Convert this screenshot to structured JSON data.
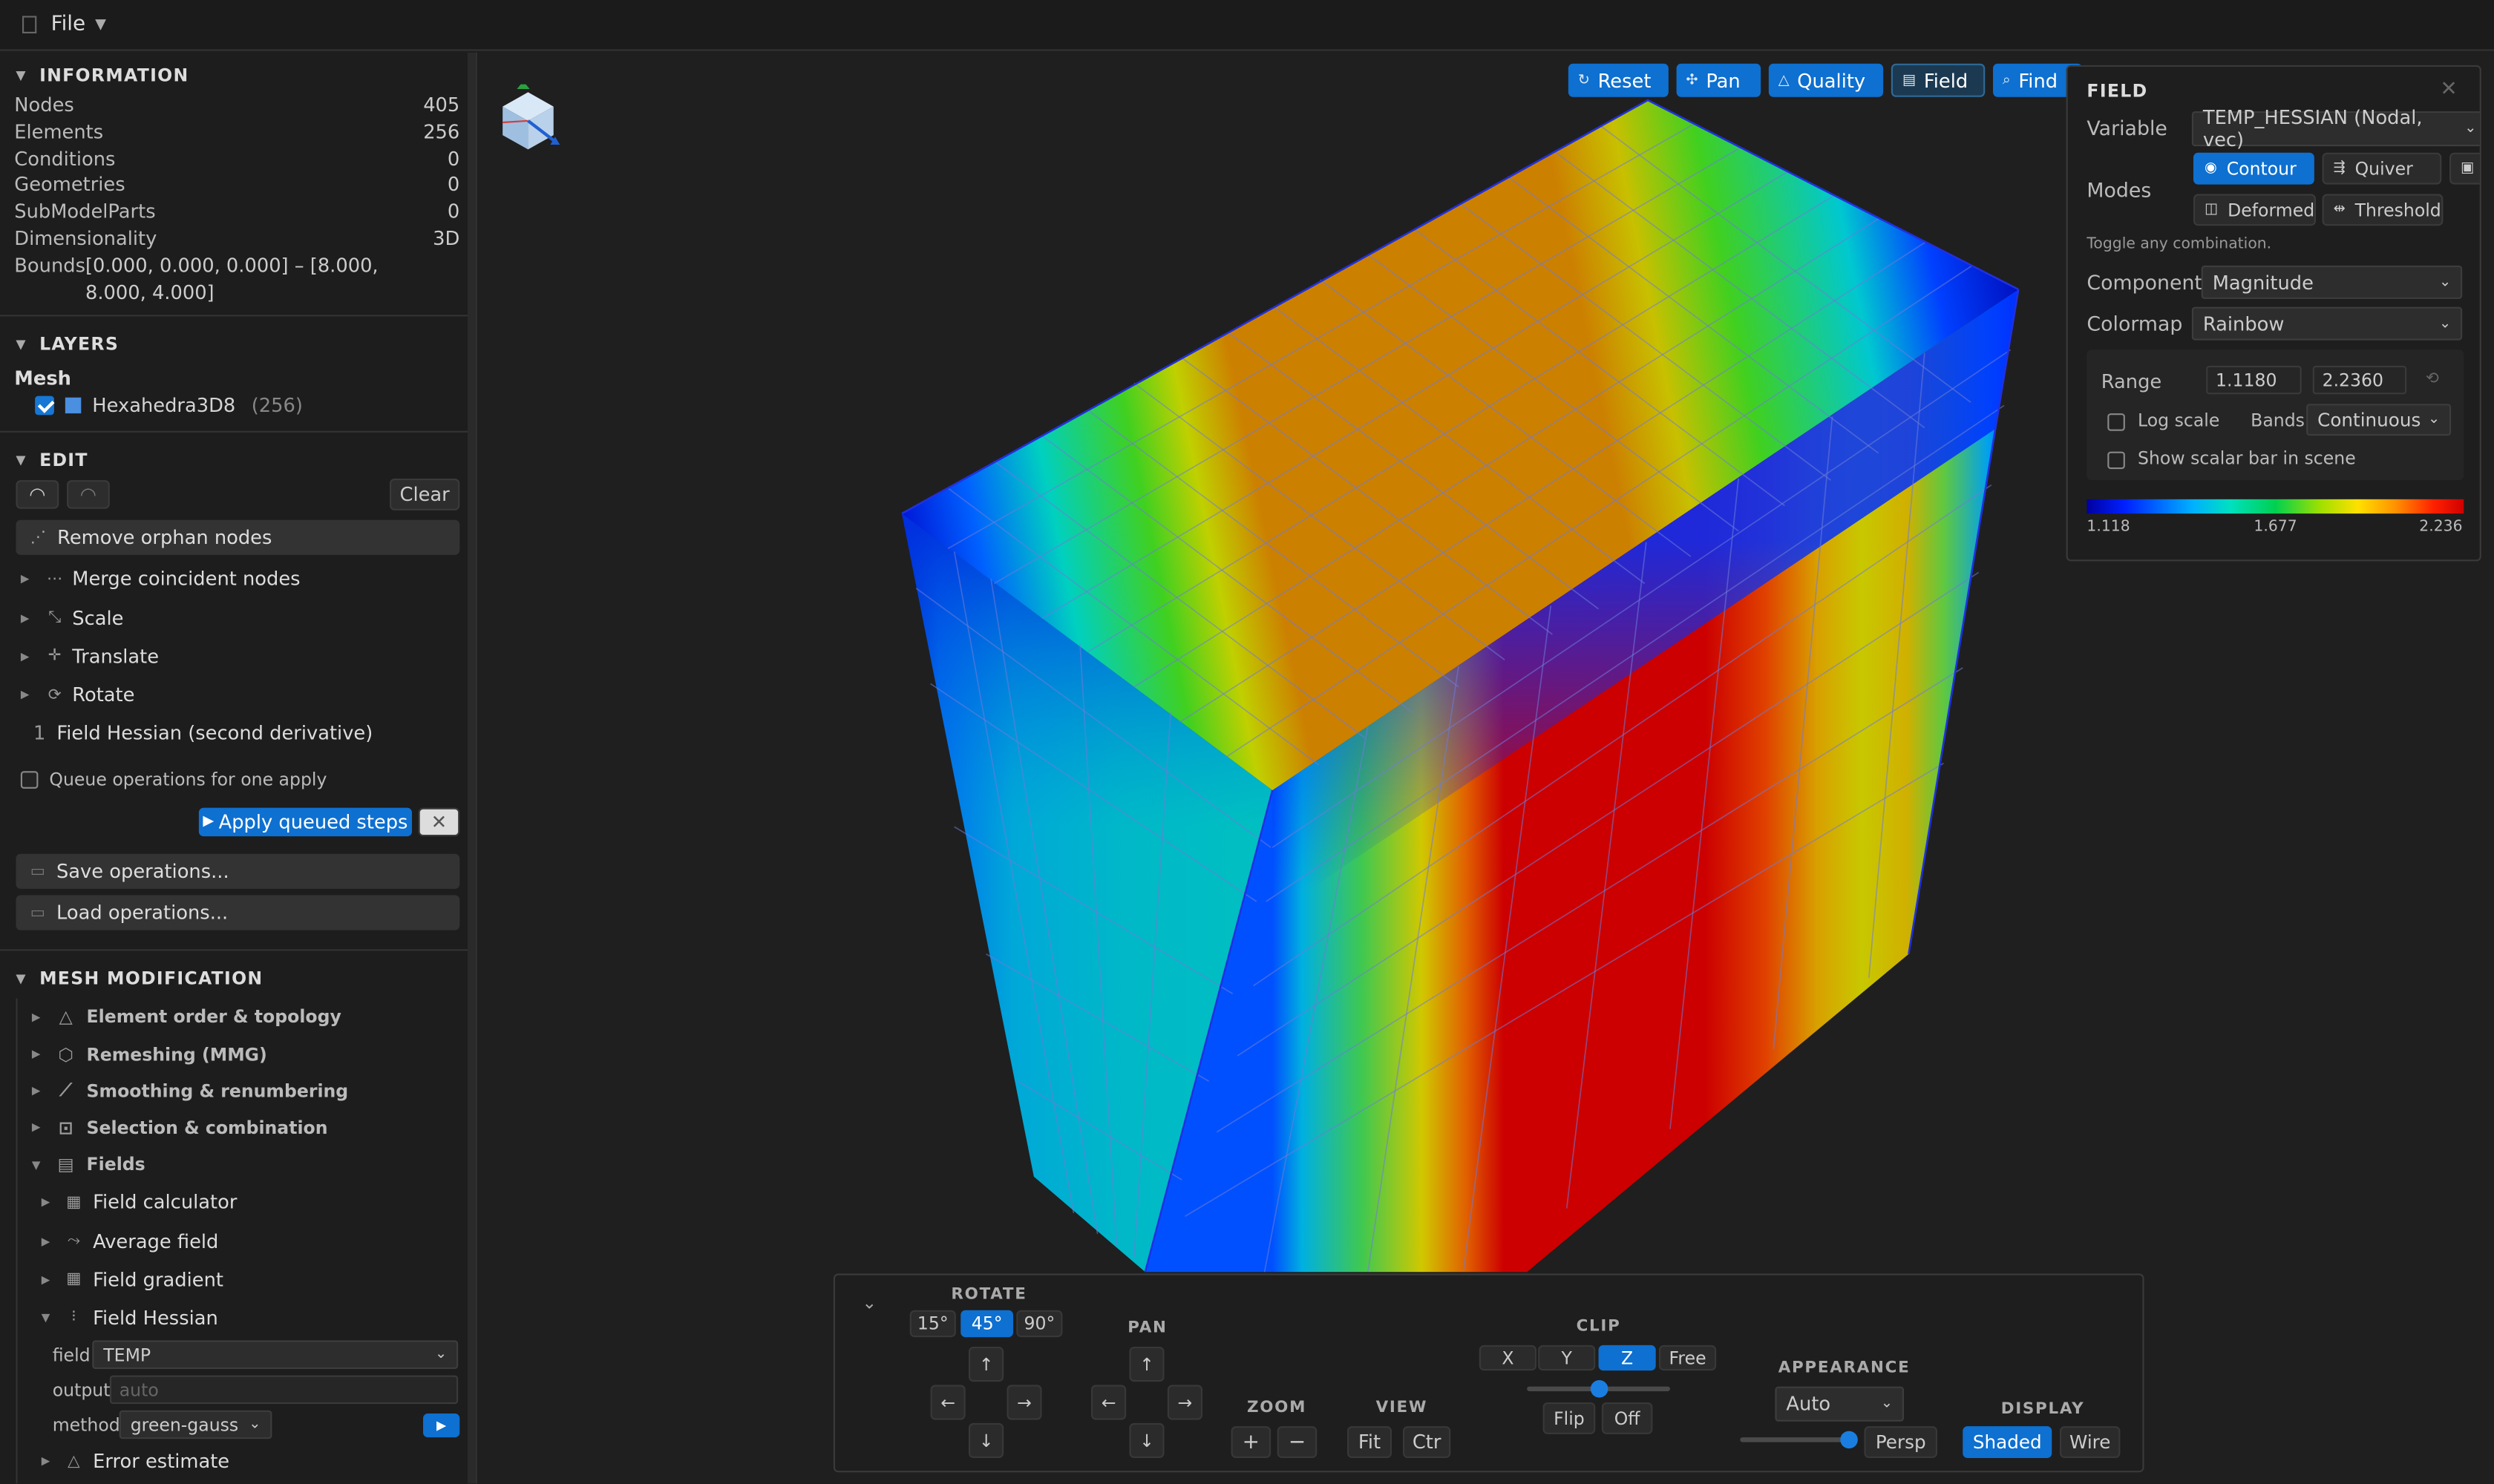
{
  "menu": {
    "file_label": "File"
  },
  "information": {
    "title": "INFORMATION",
    "rows": [
      {
        "label": "Nodes",
        "value": "405"
      },
      {
        "label": "Elements",
        "value": "256"
      },
      {
        "label": "Conditions",
        "value": "0"
      },
      {
        "label": "Geometries",
        "value": "0"
      },
      {
        "label": "SubModelParts",
        "value": "0"
      },
      {
        "label": "Dimensionality",
        "value": "3D"
      }
    ],
    "bounds_label": "Bounds",
    "bounds_value": "[0.000, 0.000, 0.000] – [8.000, 8.000, 4.000]"
  },
  "layers": {
    "title": "LAYERS",
    "group": "Mesh",
    "item_label": "Hexahedra3D8",
    "item_count": "(256)",
    "item_color": "#4a8fe0"
  },
  "edit": {
    "title": "EDIT",
    "clear_label": "Clear",
    "remove_orphan_label": "Remove orphan nodes",
    "items": [
      "Merge coincident nodes",
      "Scale",
      "Translate",
      "Rotate"
    ],
    "queued_index": "1",
    "queued_label": "Field Hessian (second derivative)",
    "queue_checkbox_label": "Queue operations for one apply",
    "apply_label": "Apply queued steps",
    "save_label": "Save operations...",
    "load_label": "Load operations..."
  },
  "mesh_modification": {
    "title": "MESH MODIFICATION",
    "items": [
      "Element order & topology",
      "Remeshing (MMG)",
      "Smoothing & renumbering",
      "Selection & combination",
      "Fields"
    ],
    "fields_items": [
      "Field calculator",
      "Average field",
      "Field gradient",
      "Field Hessian"
    ],
    "hessian": {
      "field_label": "field",
      "field_value": "TEMP",
      "output_label": "output",
      "output_placeholder": "auto",
      "method_label": "method",
      "method_value": "green-gauss"
    },
    "error_estimate_label": "Error estimate"
  },
  "toolbar": {
    "reset": "Reset",
    "pan": "Pan",
    "quality": "Quality",
    "field": "Field",
    "find": "Find"
  },
  "field_panel": {
    "title": "FIELD",
    "variable_label": "Variable",
    "variable_value": "TEMP_HESSIAN (Nodal, vec)",
    "modes_label": "Modes",
    "contour": "Contour",
    "quiver": "Quiver",
    "iso_partial": "Is",
    "deformed": "Deformed",
    "threshold": "Threshold",
    "toggle_hint": "Toggle any combination.",
    "component_label": "Component",
    "component_value": "Magnitude",
    "colormap_label": "Colormap",
    "colormap_value": "Rainbow",
    "range_label": "Range",
    "range_min": "1.1180",
    "range_max": "2.2360",
    "log_scale_label": "Log scale",
    "bands_label": "Bands",
    "bands_value": "Continuous",
    "scalar_bar_label": "Show scalar bar in scene",
    "cbar_min": "1.118",
    "cbar_mid": "1.677",
    "cbar_max": "2.236"
  },
  "controls": {
    "rotate_label": "ROTATE",
    "rotate_steps": [
      "15°",
      "45°",
      "90°"
    ],
    "pan_label": "PAN",
    "zoom_label": "ZOOM",
    "view_label": "VIEW",
    "fit": "Fit",
    "ctr": "Ctr",
    "clip_label": "CLIP",
    "clip_axes": [
      "X",
      "Y",
      "Z",
      "Free"
    ],
    "flip": "Flip",
    "off": "Off",
    "appearance_label": "APPEARANCE",
    "appearance_value": "Auto",
    "persp": "Persp",
    "display_label": "DISPLAY",
    "shaded": "Shaded",
    "wire": "Wire",
    "arrows": {
      "up": "↑",
      "down": "↓",
      "left": "←",
      "right": "→"
    },
    "plus": "+",
    "minus": "−"
  }
}
